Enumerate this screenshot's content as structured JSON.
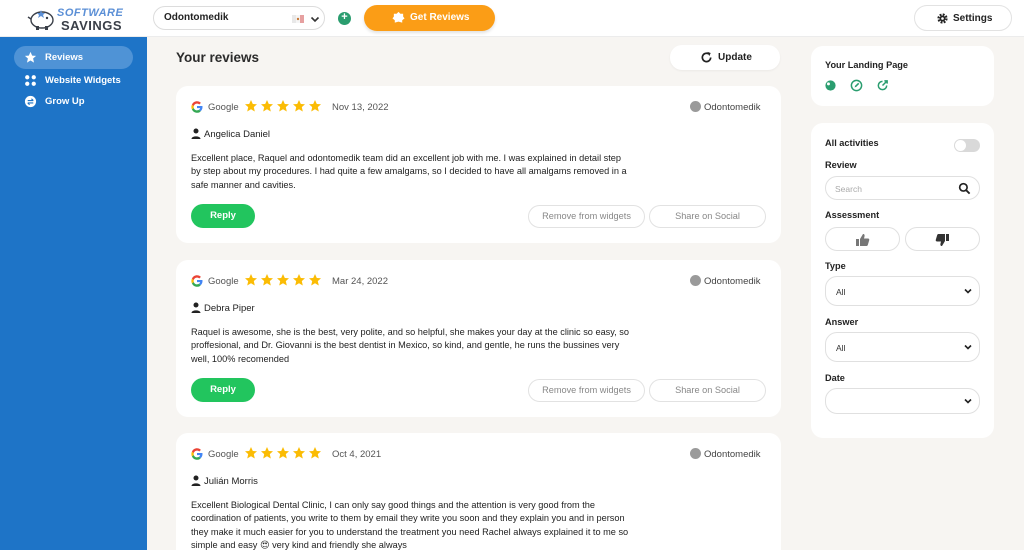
{
  "brand": {
    "line1": "SOFTWARE",
    "line2": "SAVINGS"
  },
  "header": {
    "business_select": "Odontomedik",
    "get_reviews_label": "Get Reviews",
    "settings_label": "Settings"
  },
  "sidebar": {
    "items": [
      {
        "label": "Reviews",
        "icon": "star-icon"
      },
      {
        "label": "Website Widgets",
        "icon": "grid-icon"
      },
      {
        "label": "Grow Up",
        "icon": "arrows-icon"
      }
    ]
  },
  "main": {
    "title": "Your reviews",
    "update_label": "Update",
    "reviews": [
      {
        "source": "Google",
        "rating": 5,
        "date": "Nov 13, 2022",
        "location": "Odontomedik",
        "author": "Angelica Daniel",
        "text": "Excellent place, Raquel and odontomedik team did an excellent job with me. I was explained in detail step by step about my procedures. I had quite a few amalgams, so I decided to have all amalgams removed in a safe manner and cavities.",
        "reply_label": "Reply",
        "remove_label": "Remove from widgets",
        "share_label": "Share on Social"
      },
      {
        "source": "Google",
        "rating": 5,
        "date": "Mar 24, 2022",
        "location": "Odontomedik",
        "author": "Debra Piper",
        "text": "Raquel is awesome, she is the best, very polite, and so helpful, she makes your day at the clinic so easy, so proffesional, and Dr. Giovanni is the best dentist in Mexico, so kind, and gentle, he runs the bussines very well, 100% recomended",
        "reply_label": "Reply",
        "remove_label": "Remove from widgets",
        "share_label": "Share on Social"
      },
      {
        "source": "Google",
        "rating": 5,
        "date": "Oct 4, 2021",
        "location": "Odontomedik",
        "author": "Julián Morris",
        "text": "Excellent Biological Dental Clinic, I can only say good things and the attention is very good from the coordination of patients, you write to them by email they write you soon and they explain you and in person they make it much easier for you to understand the treatment you need Rachel always explained it to me so simple and easy 😍 very kind and friendly she always",
        "reply_label": "Reply",
        "remove_label": "Remove from widgets",
        "share_label": "Share on Social"
      }
    ]
  },
  "landing": {
    "title": "Your Landing Page"
  },
  "filters": {
    "all_activities_label": "All activities",
    "all_activities_on": false,
    "review_label": "Review",
    "search_placeholder": "Search",
    "assessment_label": "Assessment",
    "type_label": "Type",
    "type_value": "All",
    "answer_label": "Answer",
    "answer_value": "All",
    "date_label": "Date",
    "date_value": ""
  },
  "colors": {
    "sidebar": "#1e74c7",
    "accent_orange": "#fb9d16",
    "reply_green": "#22c55e",
    "star": "#fbbc04",
    "landing_green": "#2a9d6f"
  }
}
